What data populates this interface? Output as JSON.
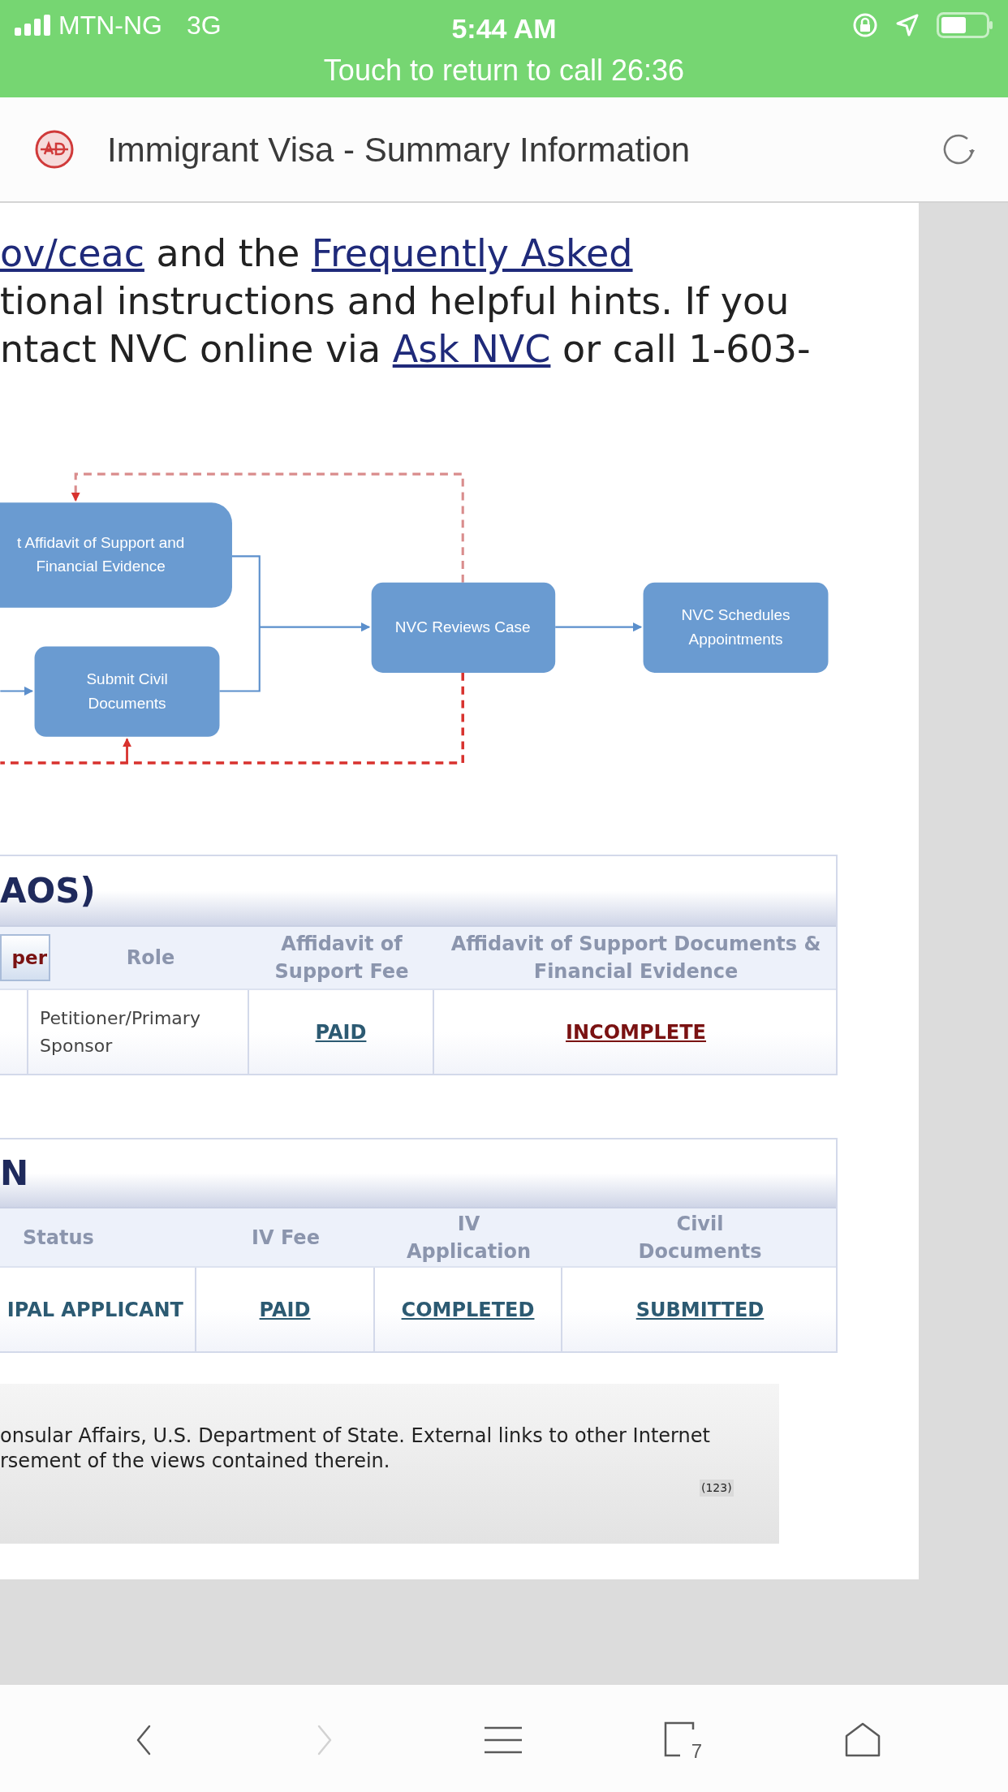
{
  "status_bar": {
    "carrier": "MTN-NG",
    "network": "3G",
    "time": "5:44 AM",
    "call_banner": "Touch to return to call 26:36"
  },
  "browser": {
    "title": "Immigrant Visa - Summary Information"
  },
  "intro_lines": [
    [
      {
        "text": "ov/ceac",
        "link": true
      },
      {
        "text": " and the ",
        "link": false
      },
      {
        "text": "Frequently Asked",
        "link": true
      }
    ],
    [
      {
        "text": "tional instructions and helpful hints. If you",
        "link": false
      }
    ],
    [
      {
        "text": "ntact NVC online via ",
        "link": false
      },
      {
        "text": "Ask NVC",
        "link": true
      },
      {
        "text": " or call 1-603-",
        "link": false
      }
    ]
  ],
  "diagram": {
    "nodes": [
      {
        "lines": [
          "t Affidavit of Support and",
          "Financial Evidence"
        ]
      },
      {
        "lines": [
          "Submit Civil",
          "Documents"
        ]
      },
      {
        "lines": [
          "NVC Reviews Case"
        ]
      },
      {
        "lines": [
          "NVC Schedules",
          "Appointments"
        ]
      }
    ]
  },
  "tables": [
    {
      "title": "AOS)",
      "columns": [
        {
          "label": "per",
          "kind": "button"
        },
        {
          "label": "Role",
          "kind": "plain"
        },
        {
          "label": "Affidavit of Support Fee",
          "kind": "plain"
        },
        {
          "label": "Affidavit of Support Documents & Financial Evidence",
          "kind": "plain"
        }
      ],
      "rows": [
        [
          {
            "text": "",
            "kind": "plain"
          },
          {
            "text": "Petitioner/Primary Sponsor",
            "kind": "plain"
          },
          {
            "text": "PAID",
            "kind": "link",
            "color": "#2c5a72"
          },
          {
            "text": "INCOMPLETE",
            "kind": "link",
            "color": "#7a1212"
          }
        ]
      ]
    },
    {
      "title": "N",
      "columns": [
        {
          "label": "Status",
          "kind": "plain"
        },
        {
          "label": "IV Fee",
          "kind": "plain"
        },
        {
          "label": "IV Application",
          "kind": "plain"
        },
        {
          "label": "Civil Documents",
          "kind": "plain"
        }
      ],
      "rows": [
        [
          {
            "text": "IPAL APPLICANT",
            "kind": "bold"
          },
          {
            "text": "PAID",
            "kind": "link",
            "color": "#2c5a72"
          },
          {
            "text": "COMPLETED",
            "kind": "link",
            "color": "#2c5a72"
          },
          {
            "text": "SUBMITTED",
            "kind": "link",
            "color": "#2c5a72"
          }
        ]
      ]
    }
  ],
  "footer": {
    "lines": [
      "onsular Affairs, U.S. Department of State. External links to other Internet",
      "rsement of the views contained therein."
    ],
    "counter": "(123)"
  },
  "toolbar": [
    {
      "kind": "back",
      "disabled": false
    },
    {
      "kind": "forward",
      "disabled": true
    },
    {
      "kind": "menu",
      "disabled": false
    },
    {
      "kind": "tabs",
      "disabled": false,
      "count": "7"
    },
    {
      "kind": "home",
      "disabled": false
    }
  ]
}
